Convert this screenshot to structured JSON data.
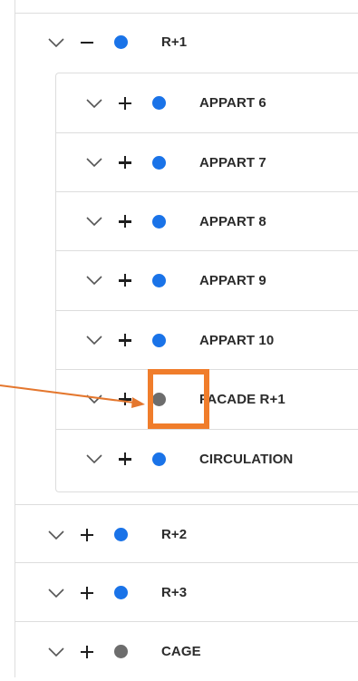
{
  "tree": {
    "groups": [
      {
        "label": "R+1",
        "dot_color": "#1a73e8",
        "expanded": true,
        "children": [
          {
            "label": "APPART 6",
            "dot_color": "#1a73e8"
          },
          {
            "label": "APPART 7",
            "dot_color": "#1a73e8"
          },
          {
            "label": "APPART 8",
            "dot_color": "#1a73e8"
          },
          {
            "label": "APPART 9",
            "dot_color": "#1a73e8"
          },
          {
            "label": "APPART 10",
            "dot_color": "#1a73e8"
          },
          {
            "label": "FACADE R+1",
            "dot_color": "#6d6d6d",
            "highlighted": true
          },
          {
            "label": "CIRCULATION",
            "dot_color": "#1a73e8"
          }
        ]
      },
      {
        "label": "R+2",
        "dot_color": "#1a73e8",
        "expanded": false
      },
      {
        "label": "R+3",
        "dot_color": "#1a73e8",
        "expanded": false
      },
      {
        "label": "CAGE",
        "dot_color": "#6d6d6d",
        "expanded": false
      }
    ]
  },
  "annotation": {
    "highlight_color": "#f07d2b",
    "arrow_color": "#e4772e"
  }
}
